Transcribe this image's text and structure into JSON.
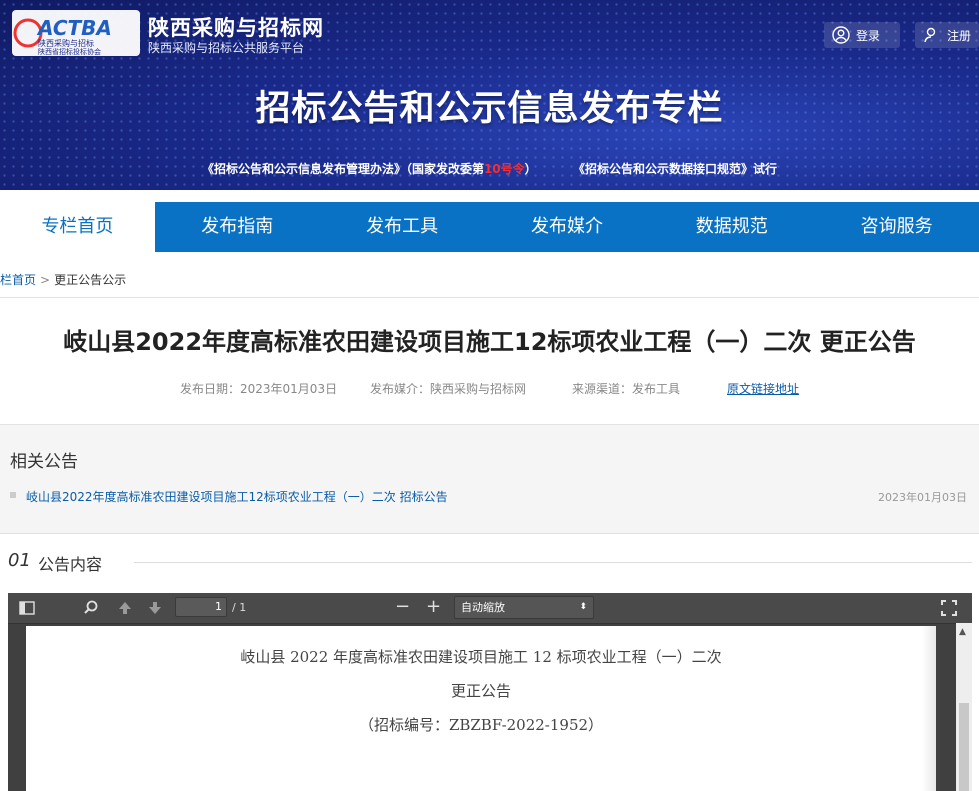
{
  "header": {
    "logo_text": "ACTBA",
    "logo_caption_1": "陕西采购与招标",
    "logo_caption_2": "陕西省招标投标协会",
    "site_name": "陕西采购与招标网",
    "site_subtitle": "陕西采购与招标公共服务平台",
    "login_label": "登录",
    "register_label": "注册",
    "banner_title": "招标公告和公示信息发布专栏",
    "link1_prefix": "《招标公告和公示信息发布管理办法》（国家发改委第",
    "link1_red": "10号令",
    "link1_suffix": "）",
    "link2": "《招标公告和公示数据接口规范》试行"
  },
  "nav": {
    "items": [
      "专栏首页",
      "发布指南",
      "发布工具",
      "发布媒介",
      "数据规范",
      "咨询服务"
    ],
    "active_index": 0
  },
  "breadcrumb": {
    "home": "栏首页",
    "separator": ">",
    "current": "更正公告公示"
  },
  "announcement": {
    "title": "岐山县2022年度高标准农田建设项目施工12标项农业工程（一）二次 更正公告",
    "publish_date": "发布日期：2023年01月03日",
    "media": "发布媒介：陕西采购与招标网",
    "source": "来源渠道：发布工具",
    "original_link": "原文链接地址"
  },
  "related": {
    "heading": "相关公告",
    "items": [
      {
        "title": "岐山县2022年度高标准农田建设项目施工12标项农业工程（一）二次  招标公告",
        "date": "2023年01月03日"
      }
    ]
  },
  "section": {
    "number": "01",
    "label": "公告内容"
  },
  "pdf_viewer": {
    "page_current": "1",
    "page_total": "/ 1",
    "zoom_label": "自动缩放",
    "zoom_out": "−",
    "zoom_in": "+",
    "doc_lines": [
      "岐山县 2022 年度高标准农田建设项目施工 12 标项农业工程（一）二次",
      "更正公告",
      "（招标编号：ZBZBF-2022-1952）"
    ]
  },
  "colors": {
    "nav_blue": "#0a72c5",
    "banner_blue": "#1a2a8c",
    "link_blue": "#0a5ca8",
    "red": "#ff2a2a"
  }
}
